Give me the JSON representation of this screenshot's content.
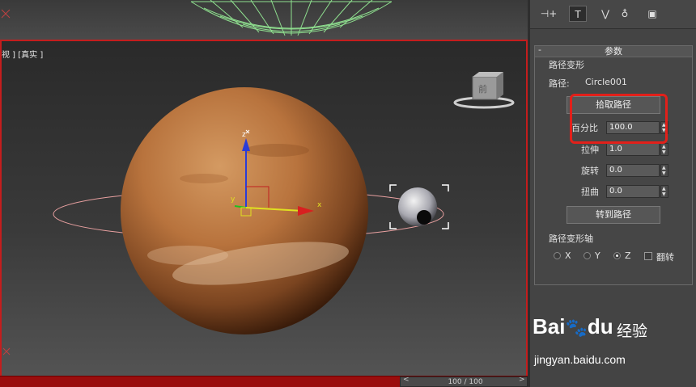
{
  "viewport": {
    "label": "视 ] [真实 ]",
    "gizmo_axis_x": "x",
    "gizmo_axis_y": "y",
    "gizmo_axis_z": "z",
    "viewcube_face": "前"
  },
  "timeline": {
    "readout": "100 / 100",
    "prev": "<",
    "next": ">"
  },
  "toolbar": {
    "items": [
      "⊣+",
      "T",
      "⋁",
      "♁",
      "▣"
    ]
  },
  "rollout": {
    "title": "参数",
    "collapse": "-"
  },
  "path_deform": {
    "group_title": "路径变形",
    "path_label": "路径:",
    "path_value": "Circle001",
    "pick_path_button": "拾取路径",
    "percent_label": "百分比",
    "percent_value": "100.0",
    "stretch_label": "拉伸",
    "stretch_value": "1.0",
    "rotation_label": "旋转",
    "rotation_value": "0.0",
    "twist_label": "扭曲",
    "twist_value": "0.0",
    "move_to_path_button": "转到路径"
  },
  "axis_group": {
    "title": "路径变形轴",
    "x": "X",
    "y": "Y",
    "z": "Z",
    "selected": "Z",
    "flip": "翻转"
  },
  "watermark": {
    "brand": "Bai",
    "brand2": "du",
    "product": "经验",
    "url": "jingyan.baidu.com"
  },
  "colors": {
    "viewport_border": "#c41d1d",
    "highlight_box": "#e2201a",
    "path_circle": "#e8a0a0",
    "planet": "#b8733d"
  }
}
